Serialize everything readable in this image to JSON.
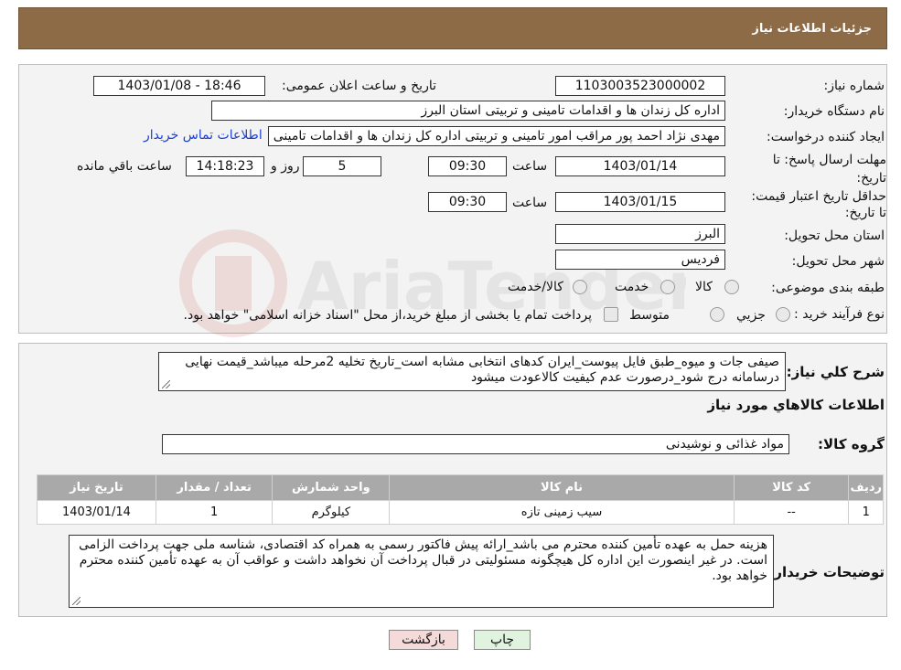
{
  "header": {
    "title": "جزئیات اطلاعات نیاز"
  },
  "form": {
    "need_number_label": "شماره نیاز:",
    "need_number": "1103003523000002",
    "announce_label": "تاریخ و ساعت اعلان عمومی:",
    "announce_value": "1403/01/08 - 18:46",
    "buyer_org_label": "نام دستگاه خریدار:",
    "buyer_org": "اداره کل زندان ها و اقدامات تامینی و تربیتی استان البرز",
    "requester_label": "ایجاد کننده درخواست:",
    "requester": "مهدی نژاد احمد پور مراقب امور تامینی و تربیتی اداره کل زندان ها و اقدامات تامینی",
    "contact_link": "اطلاعات تماس خریدار",
    "reply_deadline_label": "مهلت ارسال پاسخ: تا تاریخ:",
    "reply_date": "1403/01/14",
    "time_label": "ساعت",
    "reply_time": "09:30",
    "days_value": "5",
    "days_label": "روز و",
    "remaining_time": "14:18:23",
    "remaining_label": "ساعت باقي مانده",
    "price_validity_label": "حداقل تاریخ اعتبار قیمت: تا تاریخ:",
    "price_date": "1403/01/15",
    "price_time": "09:30",
    "province_label": "استان محل تحویل:",
    "province": "البرز",
    "city_label": "شهر محل تحویل:",
    "city": "فردیس",
    "category_label": "طبقه بندی موضوعی:",
    "category_options": [
      "کالا",
      "خدمت",
      "کالا/خدمت"
    ],
    "process_label": "نوع فرآیند خرید :",
    "process_options": [
      "جزيي",
      "متوسط"
    ],
    "payment_note": "پرداخت تمام یا بخشی از مبلغ خرید،از محل \"اسناد خزانه اسلامی\" خواهد بود."
  },
  "details": {
    "summary_label": "شرح کلي نياز:",
    "summary": "صیفی جات و میوه_طبق فایل پیوست_ایران کدهای انتخابی مشابه است_تاریخ تخلیه 2مرحله میباشد_قیمت نهایی درسامانه درج شود_درصورت عدم کیفیت کالاعودت میشود",
    "goods_info_title": "اطلاعات کالاهاي مورد نياز",
    "goods_group_label": "گروه کالا:",
    "goods_group": "مواد غذائی و نوشیدنی",
    "table": {
      "headers": [
        "رديف",
        "کد کالا",
        "نام کالا",
        "واحد شمارش",
        "تعداد / مقدار",
        "تاريخ نياز"
      ],
      "rows": [
        [
          "1",
          "--",
          "سیب زمینی تازه",
          "کیلوگرم",
          "1",
          "1403/01/14"
        ]
      ]
    },
    "buyer_notes_label": "توضیحات خریدار:",
    "buyer_notes": "هزینه حمل به عهده تأمین کننده محترم می باشد_ارائه پیش فاکتور رسمی به همراه کد اقتصادی، شناسه ملی جهت پرداخت الزامی است. در غیر اینصورت این اداره کل هیچگونه مسئولیتی در قبال پرداخت آن نخواهد داشت و عواقب آن به عهده تأمین کننده محترم خواهد بود."
  },
  "buttons": {
    "print": "چاپ",
    "back": "بازگشت"
  },
  "watermark": {
    "text": "AriaTender.neT"
  },
  "colors": {
    "header_bg": "#8e6b47",
    "link": "#1a3fd6",
    "back_btn_bg": "#f5dada",
    "print_btn_bg": "#dff3df"
  }
}
